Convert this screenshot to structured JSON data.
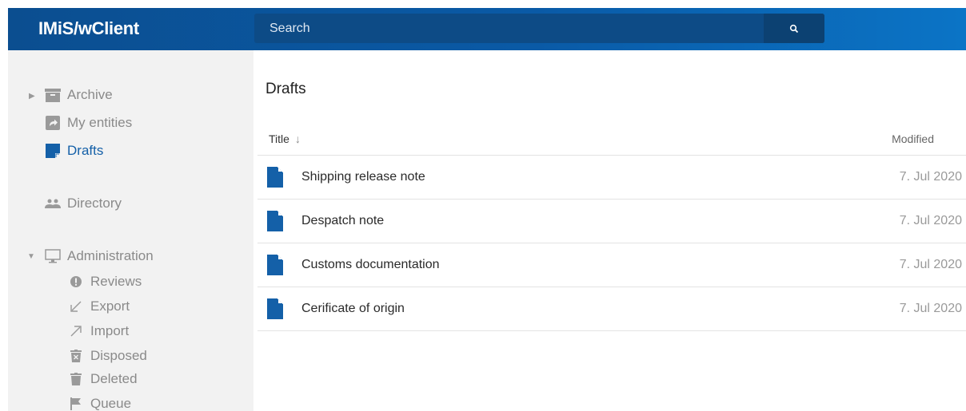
{
  "app": {
    "title": "IMiS/wClient"
  },
  "search": {
    "placeholder": "Search",
    "icon": "search-icon"
  },
  "sidebar": {
    "archive": {
      "label": "Archive",
      "icon": "archive-icon"
    },
    "my_entities": {
      "label": "My entities",
      "icon": "share-icon"
    },
    "drafts": {
      "label": "Drafts",
      "icon": "draft-icon",
      "active": true
    },
    "directory": {
      "label": "Directory",
      "icon": "people-icon"
    },
    "administration": {
      "label": "Administration",
      "icon": "monitor-icon",
      "items": [
        {
          "label": "Reviews",
          "icon": "alert-circle-icon"
        },
        {
          "label": "Export",
          "icon": "arrow-down-left-icon"
        },
        {
          "label": "Import",
          "icon": "arrow-up-right-icon"
        },
        {
          "label": "Disposed",
          "icon": "disposed-trash-icon"
        },
        {
          "label": "Deleted",
          "icon": "trash-icon"
        },
        {
          "label": "Queue",
          "icon": "flag-icon"
        }
      ]
    }
  },
  "main": {
    "title": "Drafts",
    "columns": {
      "title": "Title",
      "sort_icon": "↓",
      "modified": "Modified"
    },
    "rows": [
      {
        "title": "Shipping release note",
        "modified": "7. Jul 2020"
      },
      {
        "title": "Despatch note",
        "modified": "7. Jul 2020"
      },
      {
        "title": "Customs documentation",
        "modified": "7. Jul 2020"
      },
      {
        "title": "Cerificate of origin",
        "modified": "7. Jul 2020"
      }
    ]
  },
  "colors": {
    "accent": "#1460a8",
    "topbar": "#0a5aa6",
    "sidebar_bg": "#f2f2f2",
    "muted": "#8a8a8a"
  }
}
